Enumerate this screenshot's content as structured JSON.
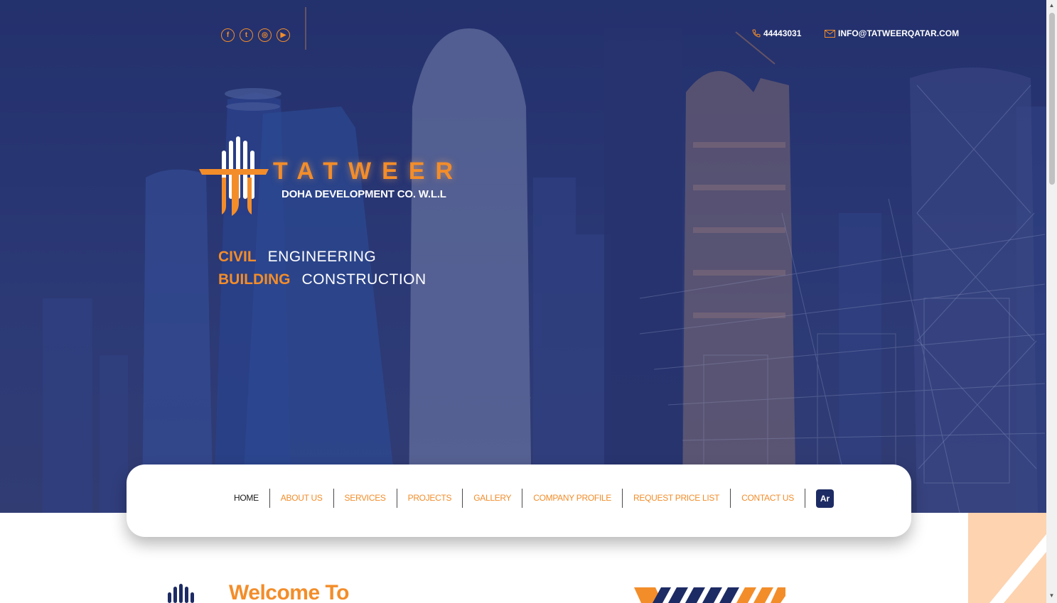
{
  "header": {
    "social": [
      {
        "name": "facebook",
        "glyph": "f"
      },
      {
        "name": "twitter",
        "glyph": "t"
      },
      {
        "name": "instagram",
        "glyph": "◎"
      },
      {
        "name": "youtube",
        "glyph": "▶"
      }
    ],
    "phone": "44443031",
    "email": "INFO@TATWEERQATAR.COM"
  },
  "brand": {
    "name": "TATWEER",
    "subtitle": "DOHA DEVELOPMENT CO. W.L.L"
  },
  "taglines": [
    {
      "accent": "CIVIL",
      "text": "ENGINEERING"
    },
    {
      "accent": "BUILDING",
      "text": "CONSTRUCTION"
    }
  ],
  "nav": {
    "items": [
      "HOME",
      "ABOUT US",
      "SERVICES",
      "PROJECTS",
      "GALLERY",
      "COMPANY PROFILE",
      "REQUEST PRICE LIST",
      "CONTACT US"
    ],
    "active": "HOME",
    "lang_button": "Ar"
  },
  "welcome": {
    "heading": "Welcome To"
  },
  "colors": {
    "accent": "#f38d2a",
    "navy": "#1d2b64",
    "hero_overlay": "#2c3a78"
  }
}
